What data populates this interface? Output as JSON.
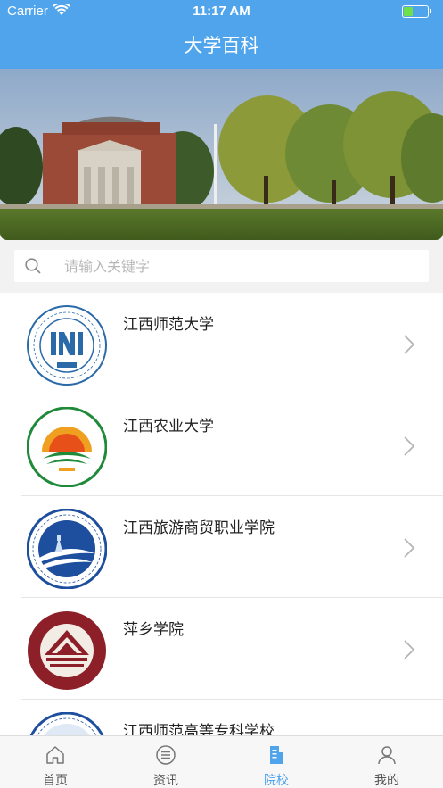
{
  "status": {
    "carrier": "Carrier",
    "time": "11:17 AM",
    "battery_level": 0.35
  },
  "nav": {
    "title": "大学百科"
  },
  "banner": {
    "image": "campus-photo"
  },
  "search": {
    "placeholder": "请输入关键字"
  },
  "schools": [
    {
      "name": "江西师范大学",
      "logo": "jxnu-logo"
    },
    {
      "name": "江西农业大学",
      "logo": "jxau-logo"
    },
    {
      "name": "江西旅游商贸职业学院",
      "logo": "jxtb-logo"
    },
    {
      "name": "萍乡学院",
      "logo": "pxu-logo"
    },
    {
      "name": "江西师范高等专科学校",
      "logo": "jxsz-logo"
    }
  ],
  "tabs": [
    {
      "label": "首页",
      "icon": "home-icon",
      "active": false
    },
    {
      "label": "资讯",
      "icon": "news-icon",
      "active": false
    },
    {
      "label": "院校",
      "icon": "school-icon",
      "active": true
    },
    {
      "label": "我的",
      "icon": "profile-icon",
      "active": false
    }
  ],
  "colors": {
    "brand": "#4fa4ec",
    "tab_inactive": "#555555",
    "battery": "#6ee04e"
  }
}
